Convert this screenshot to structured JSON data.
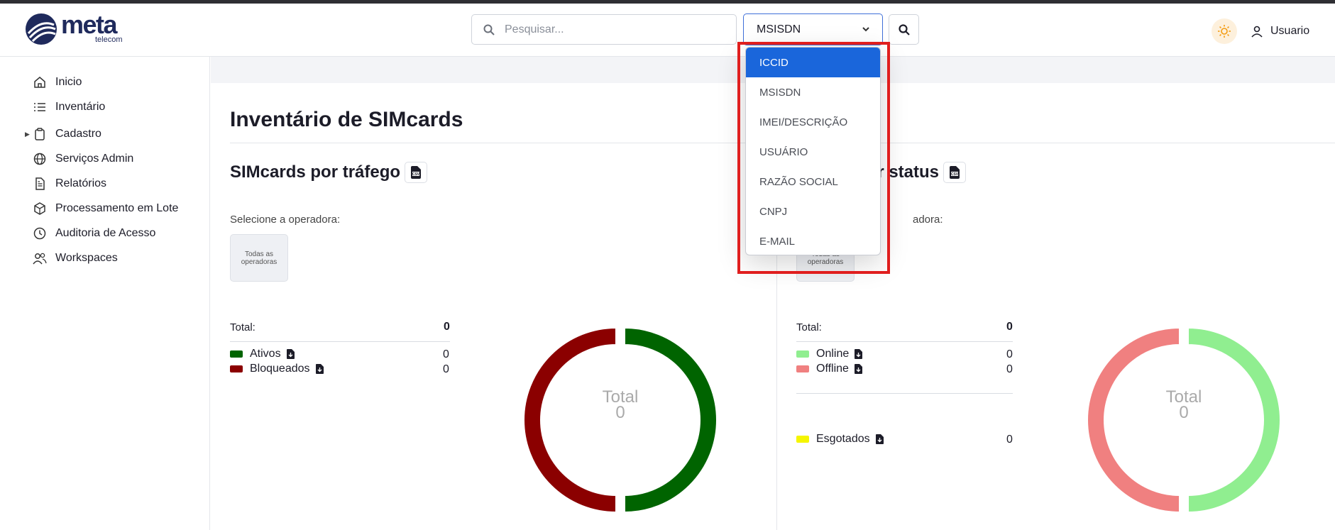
{
  "header": {
    "logo_text": "meta",
    "logo_sub": "telecom",
    "search_placeholder": "Pesquisar...",
    "search_type_selected": "MSISDN",
    "user_label": "Usuario"
  },
  "dropdown": {
    "options": [
      "ICCID",
      "MSISDN",
      "IMEI/DESCRIÇÃO",
      "USUÁRIO",
      "RAZÃO SOCIAL",
      "CNPJ",
      "E-MAIL"
    ],
    "highlighted_index": 0
  },
  "sidebar": {
    "items": [
      {
        "label": "Inicio",
        "icon": "home-icon"
      },
      {
        "label": "Inventário",
        "icon": "list-icon"
      },
      {
        "label": "Cadastro",
        "icon": "clipboard-icon"
      },
      {
        "label": "Serviços Admin",
        "icon": "globe-icon"
      },
      {
        "label": "Relatórios",
        "icon": "document-icon"
      },
      {
        "label": "Processamento em Lote",
        "icon": "box-icon"
      },
      {
        "label": "Auditoria de Acesso",
        "icon": "clock-icon"
      },
      {
        "label": "Workspaces",
        "icon": "users-icon"
      }
    ]
  },
  "page": {
    "title": "Inventário de SIMcards"
  },
  "traffic_panel": {
    "title": "SIMcards por tráfego",
    "operator_label": "Selecione a operadora:",
    "operator_option": "Todas as operadoras",
    "total_label": "Total:",
    "total_value": "0",
    "legend": [
      {
        "label": "Ativos",
        "value": "0",
        "color": "#006400"
      },
      {
        "label": "Bloqueados",
        "value": "0",
        "color": "#8b0000"
      }
    ],
    "donut_label": "Total",
    "donut_value": "0"
  },
  "status_panel": {
    "title_visible": "por status",
    "operator_label_visible": "adora:",
    "operator_option": "Todas as operadoras",
    "total_label": "Total:",
    "total_value": "0",
    "legend": [
      {
        "label": "Online",
        "value": "0",
        "color": "#90ee90"
      },
      {
        "label": "Offline",
        "value": "0",
        "color": "#f08080"
      },
      {
        "label": "Esgotados",
        "value": "0",
        "color": "#f5f500"
      }
    ],
    "donut_label": "Total",
    "donut_value": "0"
  }
}
